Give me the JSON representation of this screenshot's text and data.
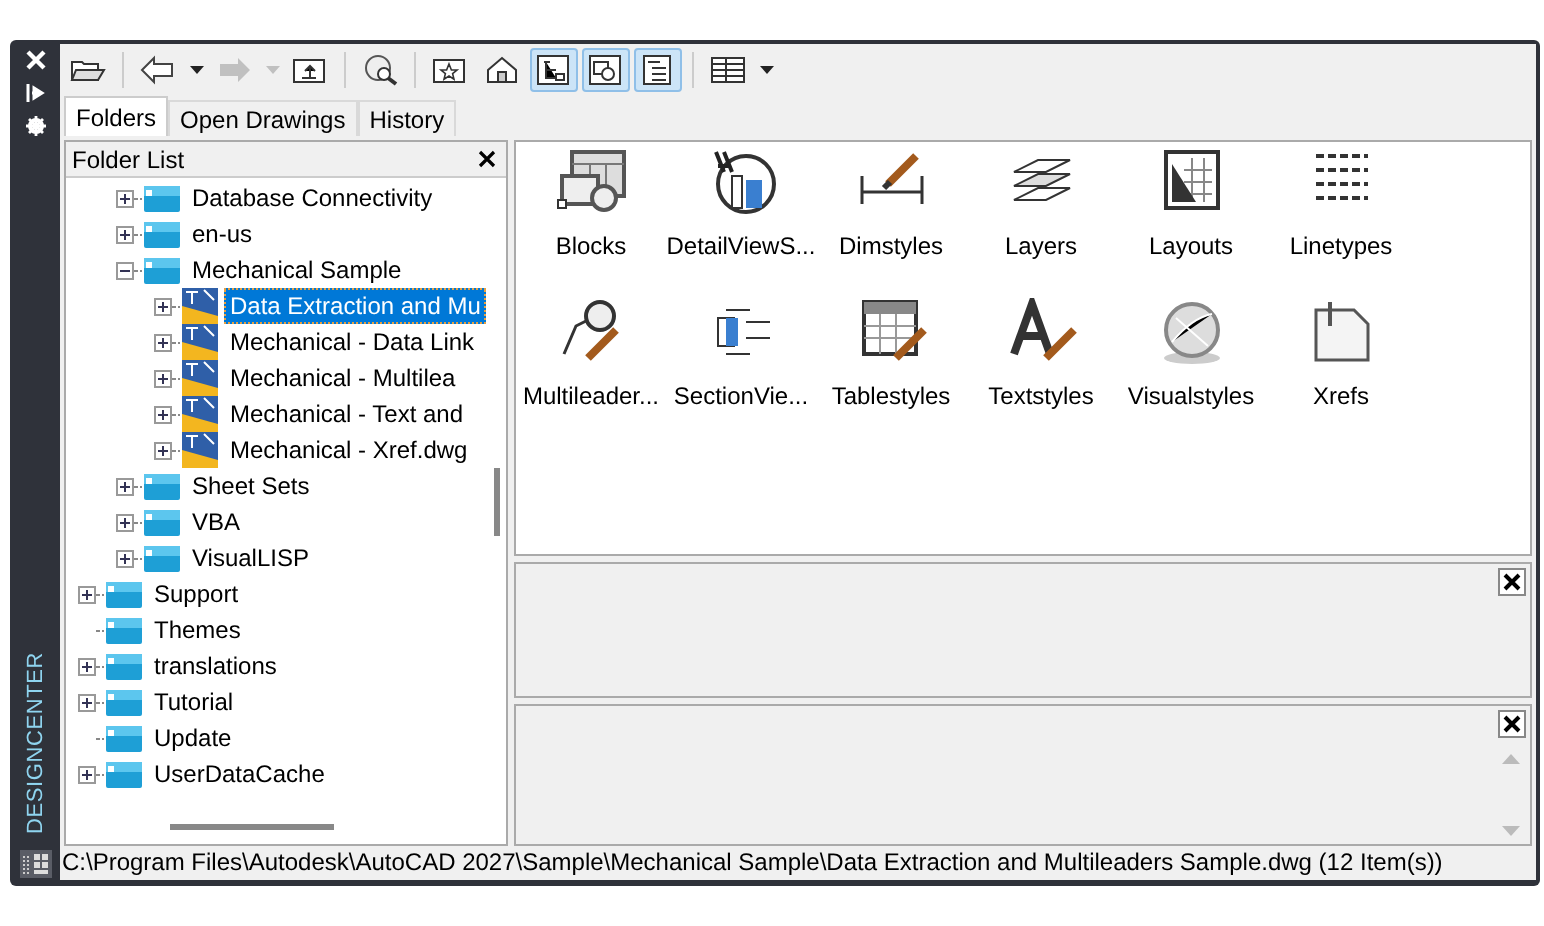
{
  "sidebar": {
    "title": "DESIGNCENTER"
  },
  "toolbar": [
    [
      {
        "kind": "load",
        "on": false,
        "disabled": false
      }
    ],
    [
      {
        "kind": "back",
        "on": false,
        "disabled": false
      },
      {
        "kind": "back-menu",
        "on": false,
        "disabled": false
      },
      {
        "kind": "forward",
        "on": false,
        "disabled": true
      },
      {
        "kind": "forward-menu",
        "on": false,
        "disabled": true
      },
      {
        "kind": "up",
        "on": false,
        "disabled": false
      }
    ],
    [
      {
        "kind": "search",
        "on": false,
        "disabled": false
      }
    ],
    [
      {
        "kind": "favorites",
        "on": false,
        "disabled": false
      },
      {
        "kind": "home",
        "on": false,
        "disabled": false
      },
      {
        "kind": "tree-toggle",
        "on": true,
        "disabled": false
      },
      {
        "kind": "preview",
        "on": true,
        "disabled": false
      },
      {
        "kind": "description",
        "on": true,
        "disabled": false
      }
    ],
    [
      {
        "kind": "views",
        "on": false,
        "disabled": false
      },
      {
        "kind": "views-menu",
        "on": false,
        "disabled": false
      }
    ]
  ],
  "tabs": [
    {
      "label": "Folders",
      "selected": true
    },
    {
      "label": "Open Drawings",
      "selected": false
    },
    {
      "label": "History",
      "selected": false
    }
  ],
  "folder_list": {
    "title": "Folder List",
    "tree": [
      {
        "children": [
          {
            "label": "Database Connectivity",
            "kind": "folder",
            "expandable": true,
            "expanded": false,
            "selected": false
          },
          {
            "label": "en-us",
            "kind": "folder",
            "expandable": true,
            "expanded": false,
            "selected": false
          },
          {
            "label": "Mechanical Sample",
            "kind": "folder",
            "expandable": true,
            "expanded": true,
            "selected": false,
            "children": [
              {
                "label": "Data Extraction and Mu",
                "kind": "drawing",
                "expandable": true,
                "expanded": false,
                "selected": true
              },
              {
                "label": "Mechanical - Data Link",
                "kind": "drawing",
                "expandable": true,
                "expanded": false,
                "selected": false
              },
              {
                "label": "Mechanical - Multilea",
                "kind": "drawing",
                "expandable": true,
                "expanded": false,
                "selected": false
              },
              {
                "label": "Mechanical - Text and",
                "kind": "drawing",
                "expandable": true,
                "expanded": false,
                "selected": false
              },
              {
                "label": "Mechanical - Xref.dwg",
                "kind": "drawing",
                "expandable": true,
                "expanded": false,
                "selected": false
              }
            ]
          },
          {
            "label": "Sheet Sets",
            "kind": "folder",
            "expandable": true,
            "expanded": false,
            "selected": false
          },
          {
            "label": "VBA",
            "kind": "folder",
            "expandable": true,
            "expanded": false,
            "selected": false
          },
          {
            "label": "VisualLISP",
            "kind": "folder",
            "expandable": true,
            "expanded": false,
            "selected": false
          }
        ]
      },
      {
        "label": "Support",
        "kind": "folder",
        "expandable": true,
        "expanded": false,
        "selected": false
      },
      {
        "label": "Themes",
        "kind": "folder",
        "expandable": false,
        "selected": false
      },
      {
        "label": "translations",
        "kind": "folder",
        "expandable": true,
        "expanded": false,
        "selected": false
      },
      {
        "label": "Tutorial",
        "kind": "folder",
        "expandable": true,
        "expanded": false,
        "selected": false
      },
      {
        "label": "Update",
        "kind": "folder",
        "expandable": false,
        "selected": false
      },
      {
        "label": "UserDataCache",
        "kind": "folder",
        "expandable": true,
        "expanded": false,
        "selected": false
      }
    ]
  },
  "content": {
    "items": [
      {
        "label": "Blocks",
        "kind": "blocks"
      },
      {
        "label": "DetailViewS...",
        "kind": "detail"
      },
      {
        "label": "Dimstyles",
        "kind": "dimension"
      },
      {
        "label": "Layers",
        "kind": "layers"
      },
      {
        "label": "Layouts",
        "kind": "layout"
      },
      {
        "label": "Linetypes",
        "kind": "lines"
      },
      {
        "label": "Multileader...",
        "kind": "leader"
      },
      {
        "label": "SectionVie...",
        "kind": "section"
      },
      {
        "label": "Tablestyles",
        "kind": "table"
      },
      {
        "label": "Textstyles",
        "kind": "text"
      },
      {
        "label": "Visualstyles",
        "kind": "sphere"
      },
      {
        "label": "Xrefs",
        "kind": "xref"
      }
    ]
  },
  "status_bar": {
    "text": "C:\\Program Files\\Autodesk\\AutoCAD 2027\\Sample\\Mechanical Sample\\Data Extraction and Multileaders Sample.dwg (12 Item(s))"
  }
}
